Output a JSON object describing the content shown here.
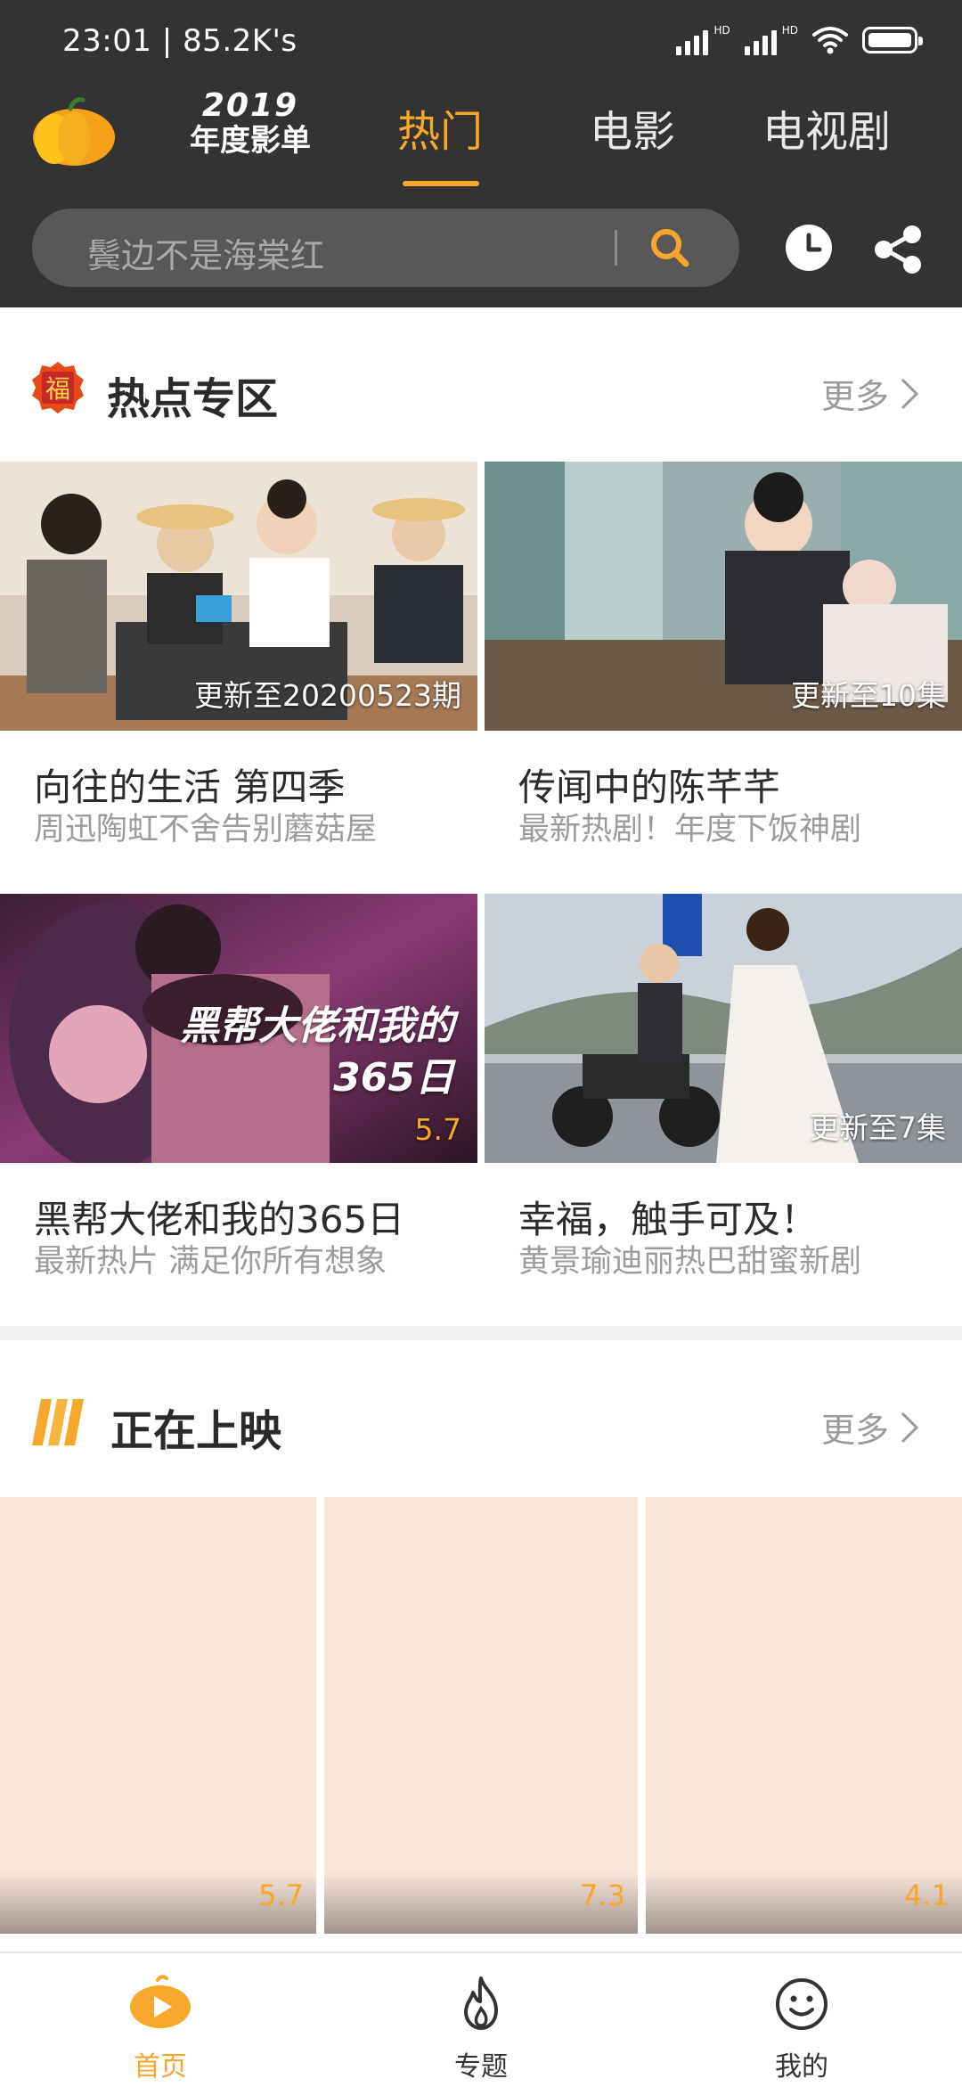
{
  "status_bar": {
    "time": "23:01 | 85.2K's",
    "signal_label": "HD"
  },
  "header": {
    "logo_year": "2019",
    "logo_text": "年度影单",
    "tabs": [
      {
        "label": "热门",
        "active": true
      },
      {
        "label": "电影",
        "active": false
      },
      {
        "label": "电视剧",
        "active": false
      }
    ]
  },
  "search": {
    "placeholder": "鬓边不是海棠红"
  },
  "hot_section": {
    "badge_char": "福",
    "title": "热点专区",
    "more_label": "更多",
    "cards": [
      {
        "title": "向往的生活 第四季",
        "subtitle": "周迅陶虹不舍告别蘑菇屋",
        "badge": "更新至20200523期"
      },
      {
        "title": "传闻中的陈芊芊",
        "subtitle": "最新热剧！年度下饭神剧",
        "badge": "更新至10集"
      },
      {
        "title": "黑帮大佬和我的365日",
        "subtitle": "最新热片 满足你所有想象",
        "badge": "5.7",
        "overlay_line1": "黑帮大佬和我的",
        "overlay_line2": "365日"
      },
      {
        "title": "幸福，触手可及！",
        "subtitle": "黄景瑜迪丽热巴甜蜜新剧",
        "badge": "更新至7集"
      }
    ]
  },
  "now_showing": {
    "title": "正在上映",
    "more_label": "更多",
    "posters": [
      {
        "score": "5.7"
      },
      {
        "score": "7.3"
      },
      {
        "score": "4.1"
      }
    ]
  },
  "bottom_nav": [
    {
      "label": "首页",
      "icon": "play-icon",
      "active": true
    },
    {
      "label": "专题",
      "icon": "flame-icon",
      "active": false
    },
    {
      "label": "我的",
      "icon": "smiley-icon",
      "active": false
    }
  ],
  "colors": {
    "accent": "#f7a72a",
    "header_bg": "#333333",
    "poster_bg": "#f8e6da"
  }
}
